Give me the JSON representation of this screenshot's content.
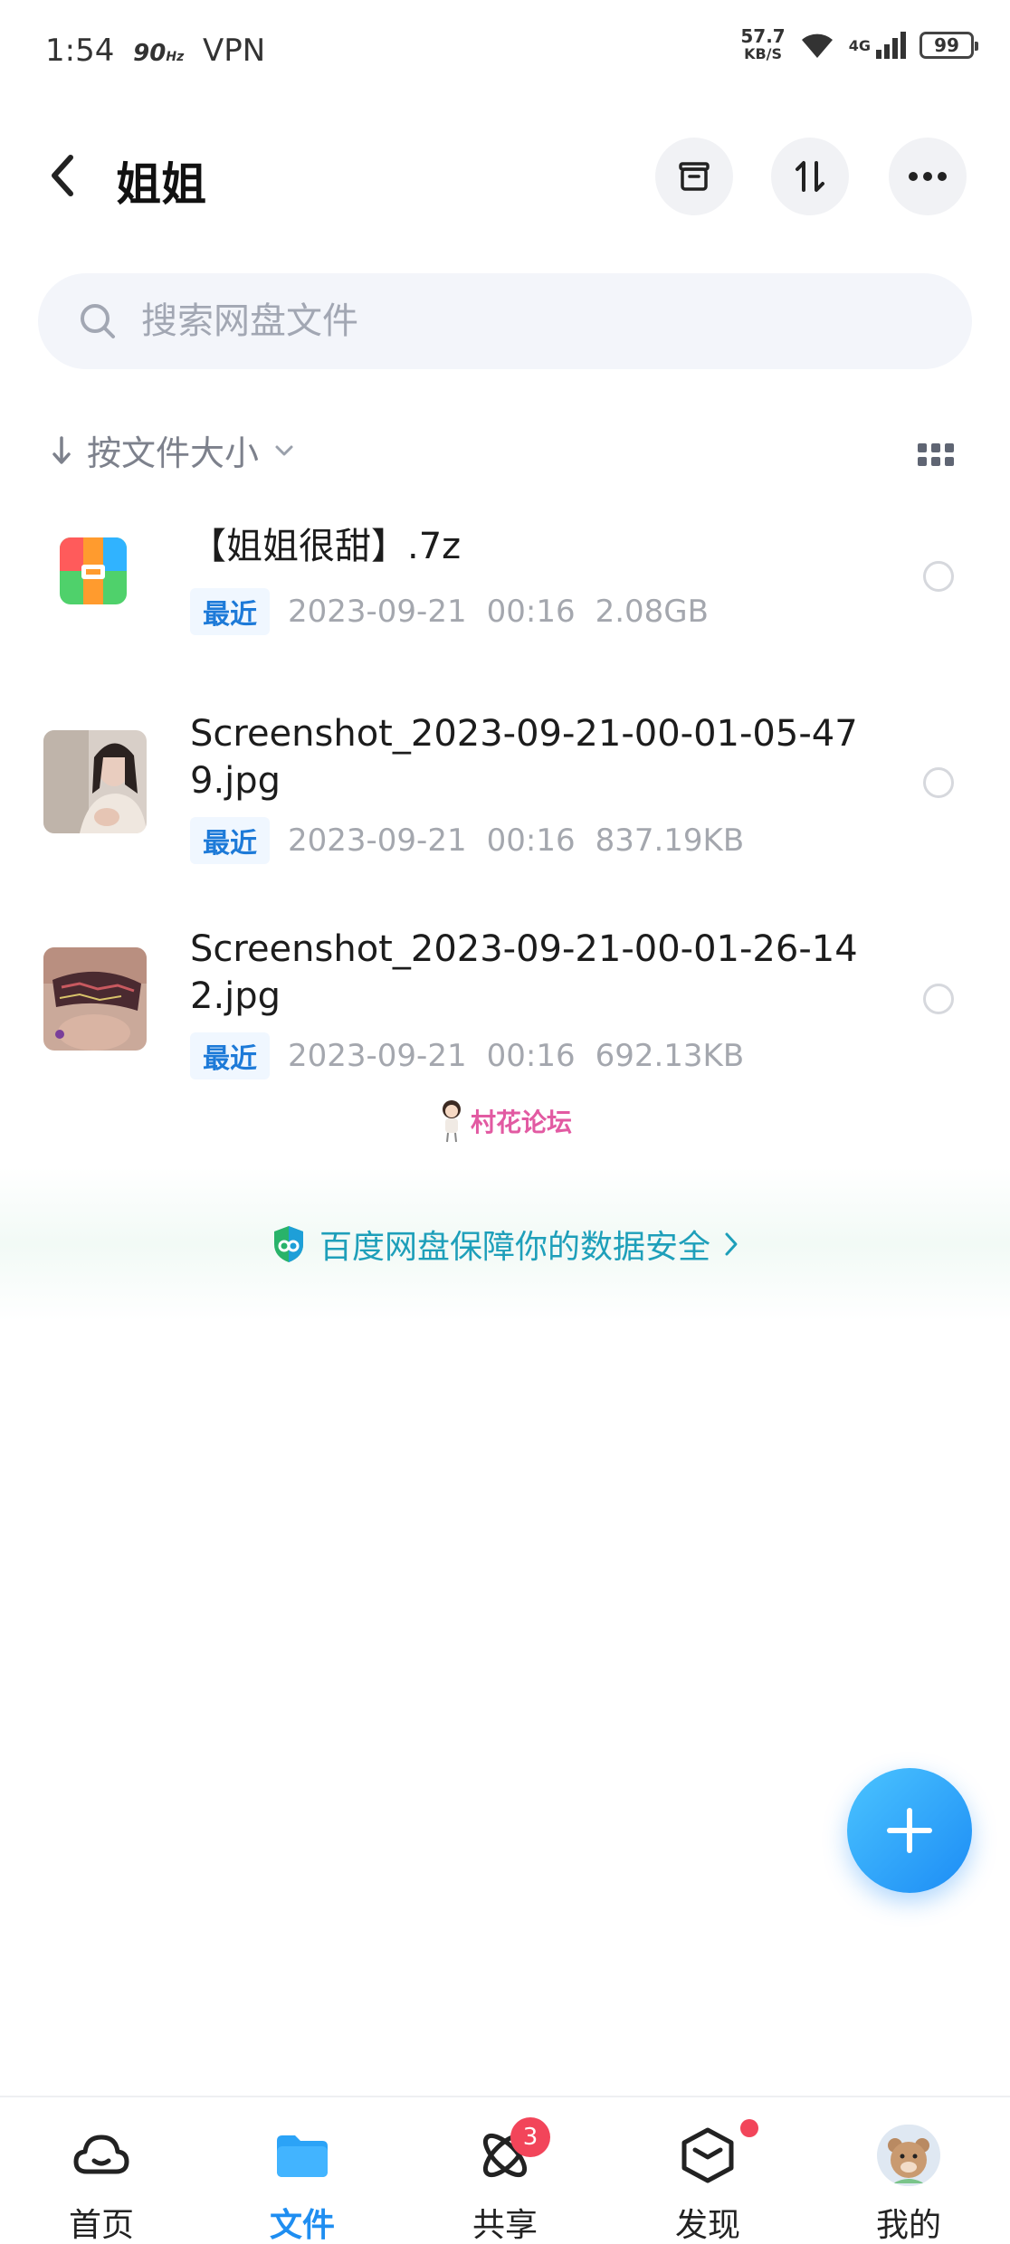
{
  "status_bar": {
    "time": "1:54",
    "refresh": "90",
    "refresh_unit": "Hz",
    "vpn": "VPN",
    "net_speed": "57.7",
    "net_speed_unit": "KB/S",
    "network": "4G",
    "battery": "99"
  },
  "header": {
    "title": "姐姐"
  },
  "search": {
    "placeholder": "搜索网盘文件"
  },
  "sort": {
    "label": "按文件大小"
  },
  "files": [
    {
      "name": "【姐姐很甜】.7z",
      "tag": "最近",
      "date": "2023-09-21",
      "time": "00:16",
      "size": "2.08GB",
      "icon": "archive-icon"
    },
    {
      "name": "Screenshot_2023-09-21-00-01-05-479.jpg",
      "tag": "最近",
      "date": "2023-09-21",
      "time": "00:16",
      "size": "837.19KB",
      "icon": "image-thumbnail"
    },
    {
      "name": "Screenshot_2023-09-21-00-01-26-142.jpg",
      "tag": "最近",
      "date": "2023-09-21",
      "time": "00:16",
      "size": "692.13KB",
      "icon": "image-thumbnail"
    }
  ],
  "watermark": "村花论坛",
  "security_banner": "百度网盘保障你的数据安全",
  "bottom_nav": {
    "items": [
      {
        "label": "首页",
        "icon": "cloud-icon"
      },
      {
        "label": "文件",
        "icon": "folder-icon",
        "active": true
      },
      {
        "label": "共享",
        "icon": "atom-icon",
        "badge": "3"
      },
      {
        "label": "发现",
        "icon": "cube-icon"
      },
      {
        "label": "我的",
        "icon": "avatar"
      }
    ]
  },
  "colors": {
    "accent": "#1f8ef1",
    "badge": "#f2455a",
    "security_text": "#1e9fba"
  }
}
